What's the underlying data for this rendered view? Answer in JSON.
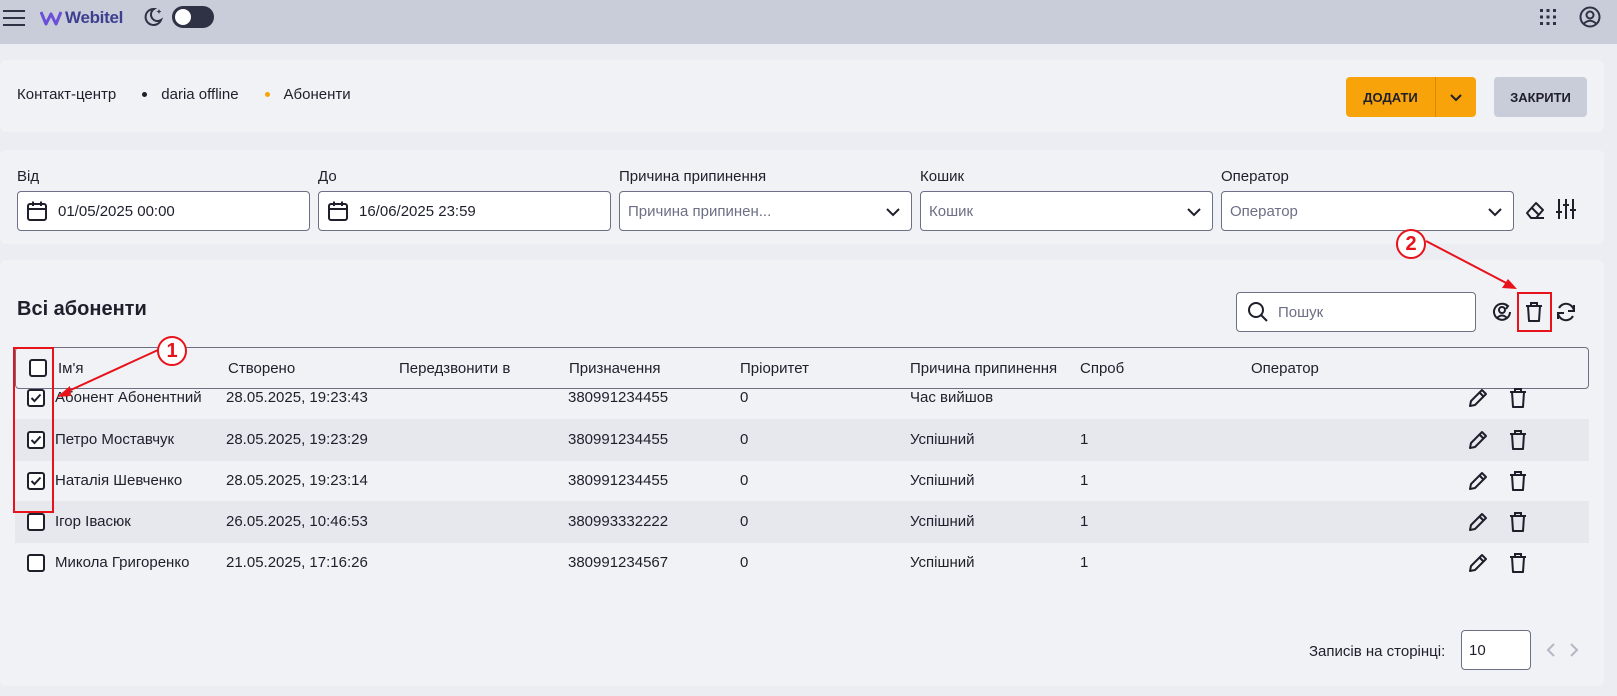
{
  "app": {
    "logo_text": "Webitel"
  },
  "breadcrumb": [
    {
      "label": "Контакт-центр",
      "dot_color": ""
    },
    {
      "label": "daria offline",
      "dot_color": "#1e1f2b"
    },
    {
      "label": "Абоненти",
      "dot_color": "#f9a30b"
    }
  ],
  "header": {
    "add_label": "ДОДАТИ",
    "close_label": "ЗАКРИТИ"
  },
  "filters": {
    "from": {
      "label": "Від",
      "value": "01/05/2025 00:00"
    },
    "to": {
      "label": "До",
      "value": "16/06/2025 23:59"
    },
    "reason": {
      "label": "Причина припинення",
      "placeholder": "Причина припинен..."
    },
    "cart": {
      "label": "Кошик",
      "placeholder": "Кошик"
    },
    "operator": {
      "label": "Оператор",
      "placeholder": "Оператор"
    }
  },
  "table": {
    "title": "Всі абоненти",
    "search_placeholder": "Пошук",
    "columns": [
      "Ім'я",
      "Створено",
      "Передзвонити в",
      "Призначення",
      "Пріоритет",
      "Причина припинення",
      "Спроб",
      "Оператор"
    ],
    "rows": [
      {
        "checked": true,
        "name": "Абонент Абонентний",
        "created": "28.05.2025, 19:23:43",
        "callback": "",
        "destination": "380991234455",
        "priority": "0",
        "reason": "Час вийшов",
        "attempts": "",
        "operator": ""
      },
      {
        "checked": true,
        "name": "Петро Моставчук",
        "created": "28.05.2025, 19:23:29",
        "callback": "",
        "destination": "380991234455",
        "priority": "0",
        "reason": "Успішний",
        "attempts": "1",
        "operator": ""
      },
      {
        "checked": true,
        "name": "Наталія Шевченко",
        "created": "28.05.2025, 19:23:14",
        "callback": "",
        "destination": "380991234455",
        "priority": "0",
        "reason": "Успішний",
        "attempts": "1",
        "operator": ""
      },
      {
        "checked": false,
        "name": "Ігор Івасюк",
        "created": "26.05.2025, 10:46:53",
        "callback": "",
        "destination": "380993332222",
        "priority": "0",
        "reason": "Успішний",
        "attempts": "1",
        "operator": ""
      },
      {
        "checked": false,
        "name": "Микола Григоренко",
        "created": "21.05.2025, 17:16:26",
        "callback": "",
        "destination": "380991234567",
        "priority": "0",
        "reason": "Успішний",
        "attempts": "1",
        "operator": ""
      }
    ]
  },
  "pagination": {
    "label": "Записів на сторінці:",
    "per_page": "10"
  },
  "annotations": {
    "marker_1": "1",
    "marker_2": "2",
    "color": "#e8121b"
  },
  "icons": [
    "hamburger-icon",
    "logo-icon",
    "moon-icon",
    "apps-grid-icon",
    "account-icon",
    "calendar-icon",
    "chevron-down-icon",
    "eraser-icon",
    "sliders-icon",
    "search-icon",
    "user-swap-icon",
    "trash-icon",
    "refresh-icon",
    "pencil-icon",
    "check-icon",
    "chevron-left-icon",
    "chevron-right-icon"
  ]
}
